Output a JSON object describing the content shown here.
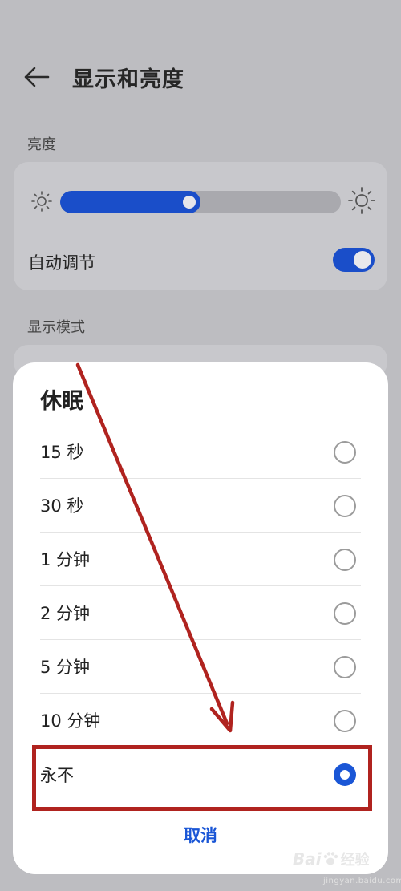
{
  "header": {
    "title": "显示和亮度",
    "back_icon": "arrow-left-icon"
  },
  "brightness": {
    "section_label": "亮度",
    "level_fraction": 0.5,
    "low_icon": "sun-small-icon",
    "high_icon": "sun-large-icon",
    "auto_label": "自动调节",
    "auto_enabled": true
  },
  "display_mode": {
    "section_label": "显示模式"
  },
  "dialog": {
    "title": "休眠",
    "options": [
      {
        "label": "15 秒",
        "selected": false
      },
      {
        "label": "30 秒",
        "selected": false
      },
      {
        "label": "1 分钟",
        "selected": false
      },
      {
        "label": "2 分钟",
        "selected": false
      },
      {
        "label": "5 分钟",
        "selected": false
      },
      {
        "label": "10 分钟",
        "selected": false
      },
      {
        "label": "永不",
        "selected": true
      }
    ],
    "cancel_label": "取消"
  },
  "annotation": {
    "color": "#b0231f"
  },
  "watermark": {
    "brand": "Bai",
    "brand_cn": "经验",
    "url": "jingyan.baidu.com"
  },
  "colors": {
    "accent": "#1a56d6",
    "toggle_on": "#1a4ec9"
  }
}
